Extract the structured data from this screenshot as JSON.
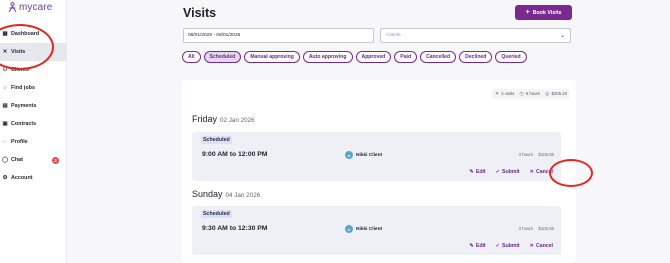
{
  "brand": {
    "name": "mycare",
    "color": "#6c3f9e"
  },
  "sidebar": {
    "items": [
      {
        "label": "Dashboard",
        "icon": "dashboard-icon",
        "glyph": "▦"
      },
      {
        "label": "Visits",
        "icon": "visits-icon",
        "glyph": "✕",
        "active": true
      },
      {
        "label": "Clients",
        "icon": "clients-icon",
        "glyph": "⚇"
      },
      {
        "label": "Find jobs",
        "icon": "search-icon",
        "glyph": "○"
      },
      {
        "label": "Payments",
        "icon": "payments-icon",
        "glyph": "▤"
      },
      {
        "label": "Contracts",
        "icon": "contracts-icon",
        "glyph": "▣"
      },
      {
        "label": "Profile",
        "icon": "profile-icon",
        "glyph": "◌"
      },
      {
        "label": "Chat",
        "icon": "chat-icon",
        "glyph": "◯",
        "badge": "2"
      },
      {
        "label": "Account",
        "icon": "gear-icon",
        "glyph": "⚙"
      }
    ]
  },
  "header": {
    "title": "Visits",
    "book_button": "Book Visits",
    "book_button_icon": "+"
  },
  "search": {
    "date_range": "08/01/2025 - 08/01/2026",
    "clients_placeholder": "Clients"
  },
  "filters": [
    {
      "label": "All"
    },
    {
      "label": "Scheduled",
      "active": true
    },
    {
      "label": "Manual approving"
    },
    {
      "label": "Auto approving"
    },
    {
      "label": "Approved"
    },
    {
      "label": "Paid"
    },
    {
      "label": "Cancelled"
    },
    {
      "label": "Declined"
    },
    {
      "label": "Queried"
    }
  ],
  "summary": {
    "visits": "2 visits",
    "hours": "6 hours",
    "amount": "$205.20"
  },
  "days": [
    {
      "weekday": "Friday",
      "date": "02 Jan 2026",
      "visit": {
        "status": "Scheduled",
        "time": "9:00 AM to 12:00 PM",
        "client": "Nikki Client",
        "hours": "3 hours",
        "amount": "$102.60",
        "edit": "Edit",
        "submit": "Submit",
        "cancel": "Cancel"
      }
    },
    {
      "weekday": "Sunday",
      "date": "04 Jan 2026",
      "visit": {
        "status": "Scheduled",
        "time": "9:30 AM to 12:30 PM",
        "client": "Nikki Client",
        "hours": "3 hours",
        "amount": "$102.60",
        "edit": "Edit",
        "submit": "Submit",
        "cancel": "Cancel"
      }
    }
  ],
  "colors": {
    "accent": "#7a2a8f",
    "annotation": "#e3271d",
    "badge": "#e24b4b"
  }
}
